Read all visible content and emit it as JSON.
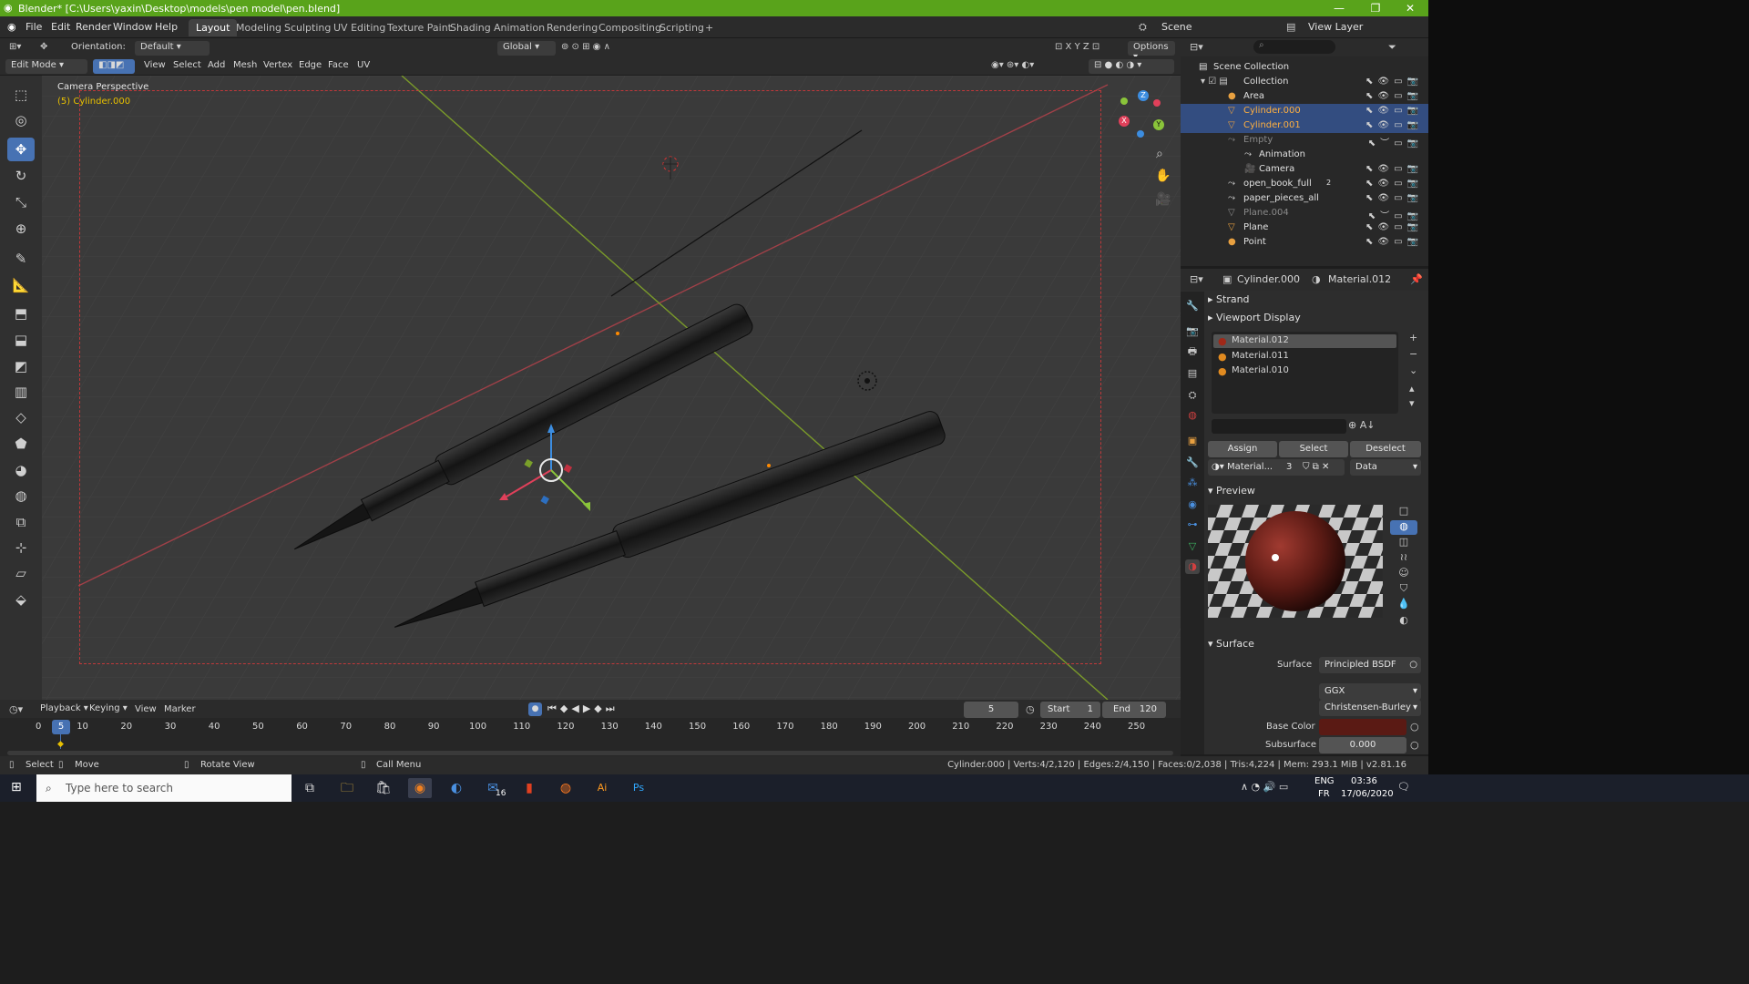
{
  "window": {
    "title": "Blender* [C:\\Users\\yaxin\\Desktop\\models\\pen model\\pen.blend]",
    "controls": [
      "—",
      "❐",
      "✕"
    ]
  },
  "menu": [
    "File",
    "Edit",
    "Render",
    "Window",
    "Help"
  ],
  "workspaces": [
    "Layout",
    "Modeling",
    "Sculpting",
    "UV Editing",
    "Texture Paint",
    "Shading",
    "Animation",
    "Rendering",
    "Compositing",
    "Scripting"
  ],
  "workspace_add": "+",
  "scene": {
    "scene_name": "Scene",
    "view_layer": "View Layer"
  },
  "header": {
    "orientation_label": "Orientation:",
    "orientation_value": "Default",
    "transform_space": "Global",
    "options": "Options"
  },
  "mode_bar": {
    "mode": "Edit Mode",
    "menus": [
      "View",
      "Select",
      "Add",
      "Mesh",
      "Vertex",
      "Edge",
      "Face",
      "UV"
    ]
  },
  "viewport": {
    "camera_label": "Camera Perspective",
    "object_label": "(5) Cylinder.000",
    "axis_x": "X",
    "axis_y": "Y",
    "axis_z": "Z",
    "accent": "#4772b3",
    "frame_color": "#c0383a"
  },
  "outliner": {
    "root": "Scene Collection",
    "items": [
      {
        "label": "Collection",
        "state": "normal"
      },
      {
        "label": "Area",
        "state": "normal"
      },
      {
        "label": "Cylinder.000",
        "state": "selected"
      },
      {
        "label": "Cylinder.001",
        "state": "selected"
      },
      {
        "label": "Empty",
        "state": "dim"
      },
      {
        "label": "Animation",
        "state": "normal"
      },
      {
        "label": "Camera",
        "state": "normal"
      },
      {
        "label": "open_book_full",
        "state": "normal"
      },
      {
        "label": "paper_pieces_all",
        "state": "normal"
      },
      {
        "label": "Plane.004",
        "state": "dim"
      },
      {
        "label": "Plane",
        "state": "normal"
      },
      {
        "label": "Point",
        "state": "normal"
      }
    ],
    "badge_2": "2"
  },
  "properties": {
    "object": "Cylinder.000",
    "material": "Material.012",
    "sections": {
      "strand": "Strand",
      "viewport_display": "Viewport Display",
      "preview": "Preview",
      "surface": "Surface"
    },
    "material_slots": [
      "Material.012",
      "Material.011",
      "Material.010"
    ],
    "buttons": {
      "assign": "Assign",
      "select": "Select",
      "deselect": "Deselect"
    },
    "material_field": "Material...",
    "material_users": "3",
    "link": "Data",
    "surface_label": "Surface",
    "surface_value": "Principled BSDF",
    "distribution": "GGX",
    "subsurface_method": "Christensen-Burley",
    "base_color_label": "Base Color",
    "base_color": "#5a1a14",
    "subsurface_label": "Subsurface",
    "subsurface_value": "0.000"
  },
  "timeline": {
    "menus": [
      "Playback",
      "Keying",
      "View",
      "Marker"
    ],
    "current_frame": "5",
    "start_label": "Start",
    "start": "1",
    "end_label": "End",
    "end": "120",
    "ticks": [
      "0",
      "10",
      "20",
      "30",
      "40",
      "50",
      "60",
      "70",
      "80",
      "90",
      "100",
      "110",
      "120",
      "130",
      "140",
      "150",
      "160",
      "170",
      "180",
      "190",
      "200",
      "210",
      "220",
      "230",
      "240",
      "250"
    ]
  },
  "status": {
    "select": "Select",
    "move": "Move",
    "rotate": "Rotate View",
    "call_menu": "Call Menu",
    "stats": "Cylinder.000 | Verts:4/2,120 | Edges:2/4,150 | Faces:0/2,038 | Tris:4,224 | Mem: 293.1 MiB | v2.81.16"
  },
  "taskbar": {
    "search_placeholder": "Type here to search",
    "lang_top": "ENG",
    "lang_bottom": "FR",
    "time": "03:36",
    "date": "17/06/2020",
    "mail_badge": "16"
  }
}
